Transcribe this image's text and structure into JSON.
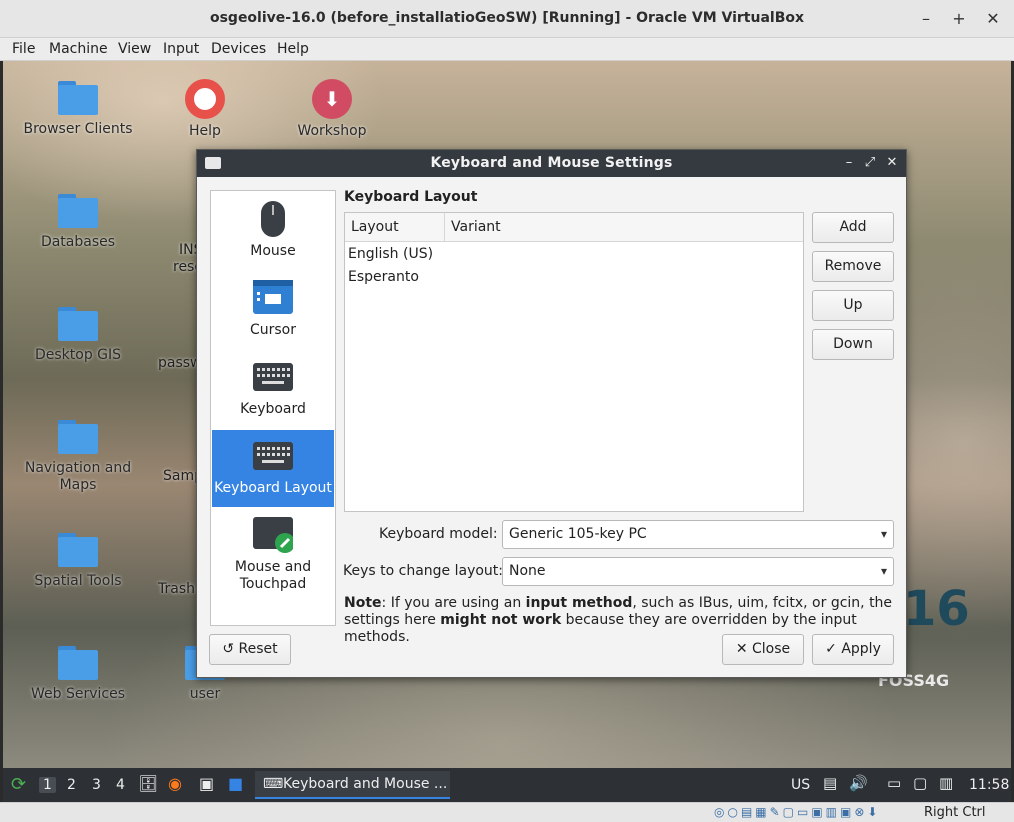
{
  "window": {
    "title": "osgeolive-16.0 (before_installatioGeoSW) [Running] - Oracle VM VirtualBox",
    "minimize": "–",
    "maximize": "+",
    "close": "✕"
  },
  "menubar": [
    "File",
    "Machine",
    "View",
    "Input",
    "Devices",
    "Help"
  ],
  "desktop": {
    "icons": [
      {
        "label": "Browser Clients"
      },
      {
        "label": "Help"
      },
      {
        "label": "Workshop"
      },
      {
        "label": "Databases"
      },
      {
        "label": "Desktop GIS"
      },
      {
        "label": "Navigation and Maps"
      },
      {
        "label": "Spatial Tools"
      },
      {
        "label": "Web Services"
      },
      {
        "label": "user"
      }
    ],
    "partial_labels": [
      "INS",
      "reso",
      "passw",
      "Samp",
      "Trash"
    ],
    "foss_number": "16",
    "foss_brand": "FOSS4G"
  },
  "dialog": {
    "title": "Keyboard and Mouse Settings",
    "sidebar": [
      {
        "label": "Mouse",
        "icon": "mouse-icon"
      },
      {
        "label": "Cursor",
        "icon": "cursor-icon"
      },
      {
        "label": "Keyboard",
        "icon": "keyboard-icon"
      },
      {
        "label": "Keyboard Layout",
        "icon": "keyboard-layout-icon",
        "selected": true
      },
      {
        "label": "Mouse and Touchpad",
        "icon": "touchpad-icon"
      }
    ],
    "section_title": "Keyboard Layout",
    "table": {
      "columns": [
        "Layout",
        "Variant"
      ],
      "rows": [
        {
          "layout": "English (US)",
          "variant": ""
        },
        {
          "layout": "Esperanto",
          "variant": ""
        }
      ]
    },
    "buttons": {
      "add": "Add",
      "remove": "Remove",
      "up": "Up",
      "down": "Down",
      "reset": "Reset",
      "close": "Close",
      "apply": "Apply"
    },
    "keyboard_model_label": "Keyboard model:",
    "keyboard_model_value": "Generic 105-key PC",
    "change_layout_label": "Keys to change layout:",
    "change_layout_value": "None",
    "note": {
      "prefix": "Note",
      "t1": ": If you are using an ",
      "b1": "input method",
      "t2": ", such as IBus, uim, fcitx, or gcin, the settings here ",
      "b2": "might not work",
      "t3": " because they are overridden by the input methods."
    }
  },
  "taskbar": {
    "workspaces": [
      "1",
      "2",
      "3",
      "4"
    ],
    "active_workspace": "1",
    "task_label": "Keyboard and Mouse ...",
    "keyboard_indicator": "US",
    "clock": "11:58"
  },
  "vb_status": {
    "host_key": "Right Ctrl"
  },
  "colors": {
    "accent": "#3584e4",
    "dialog_titlebar": "#353a40",
    "taskbar": "#2d3136"
  }
}
